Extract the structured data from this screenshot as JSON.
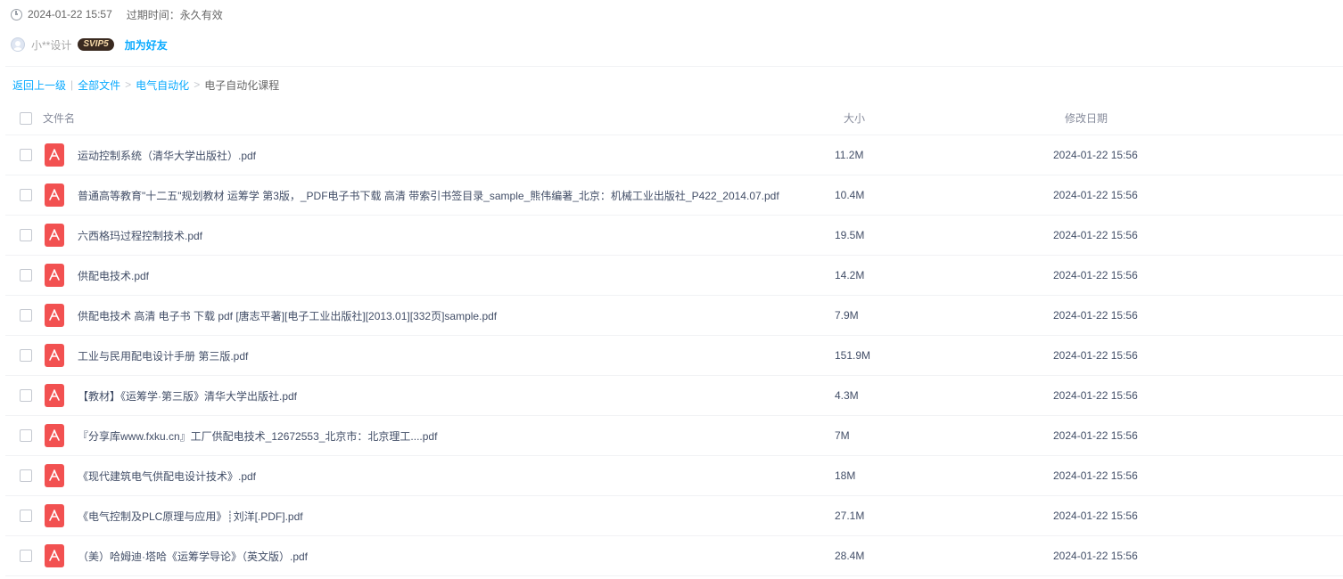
{
  "meta": {
    "share_time": "2024-01-22 15:57",
    "expire_label": "过期时间：永久有效"
  },
  "user": {
    "name": "小**设计",
    "badge": "SVIP5",
    "add_friend": "加为好友"
  },
  "breadcrumb": {
    "back": "返回上一级",
    "all": "全部文件",
    "parent": "电气自动化",
    "current": "电子自动化课程"
  },
  "table": {
    "headers": {
      "name": "文件名",
      "size": "大小",
      "date": "修改日期"
    },
    "rows": [
      {
        "name": "运动控制系统（清华大学出版社）.pdf",
        "size": "11.2M",
        "date": "2024-01-22 15:56"
      },
      {
        "name": "普通高等教育\"十二五\"规划教材 运筹学 第3版，_PDF电子书下载 高清 带索引书签目录_sample_熊伟编著_北京：机械工业出版社_P422_2014.07.pdf",
        "size": "10.4M",
        "date": "2024-01-22 15:56"
      },
      {
        "name": "六西格玛过程控制技术.pdf",
        "size": "19.5M",
        "date": "2024-01-22 15:56"
      },
      {
        "name": "供配电技术.pdf",
        "size": "14.2M",
        "date": "2024-01-22 15:56"
      },
      {
        "name": "供配电技术 高清 电子书 下载 pdf [唐志平著][电子工业出版社][2013.01][332页]sample.pdf",
        "size": "7.9M",
        "date": "2024-01-22 15:56"
      },
      {
        "name": "工业与民用配电设计手册 第三版.pdf",
        "size": "151.9M",
        "date": "2024-01-22 15:56"
      },
      {
        "name": "【教材】《运筹学·第三版》清华大学出版社.pdf",
        "size": "4.3M",
        "date": "2024-01-22 15:56"
      },
      {
        "name": "『分享库www.fxku.cn』工厂供配电技术_12672553_北京市：北京理工....pdf",
        "size": "7M",
        "date": "2024-01-22 15:56"
      },
      {
        "name": "《现代建筑电气供配电设计技术》.pdf",
        "size": "18M",
        "date": "2024-01-22 15:56"
      },
      {
        "name": "《电气控制及PLC原理与应用》┊刘洋[.PDF].pdf",
        "size": "27.1M",
        "date": "2024-01-22 15:56"
      },
      {
        "name": "（美）哈姆迪·塔哈《运筹学导论》（英文版）.pdf",
        "size": "28.4M",
        "date": "2024-01-22 15:56"
      }
    ]
  },
  "icons": {
    "file_type": "pdf-icon",
    "time": "clock-icon",
    "user": "avatar-icon"
  },
  "colors": {
    "link": "#09aaff",
    "pdf": "#f25151",
    "text": "#424e67"
  }
}
